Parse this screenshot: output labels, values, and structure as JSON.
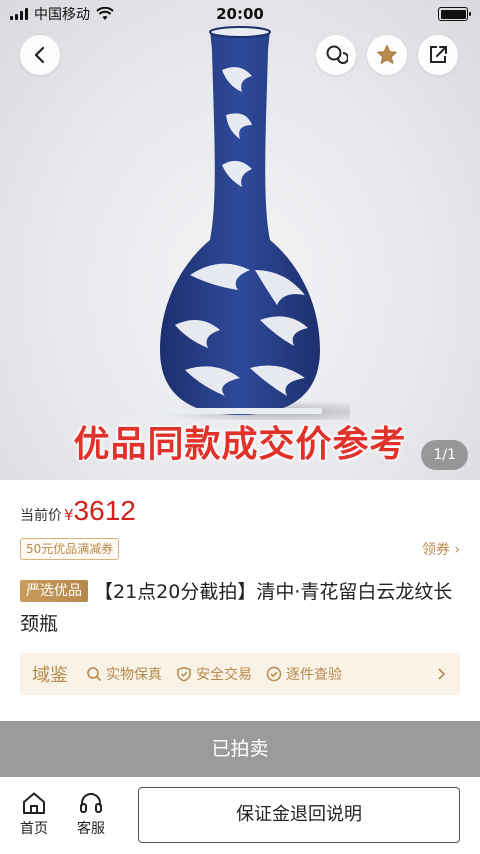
{
  "status": {
    "carrier": "中国移动",
    "time": "20:00"
  },
  "hero": {
    "banner": "优品同款成交价参考",
    "pager": "1/1"
  },
  "price": {
    "label": "当前价",
    "currency": "¥",
    "value": "3612"
  },
  "coupon": "50元优品满减券",
  "claim": "领券 ›",
  "item": {
    "tag": "严选优品",
    "title": "【21点20分截拍】清中·青花留白云龙纹长颈瓶"
  },
  "assurance": {
    "brand": "域鉴",
    "items": [
      "实物保真",
      "安全交易",
      "逐件查验"
    ]
  },
  "sold_label": "已拍卖",
  "bottom": {
    "home": "首页",
    "service": "客服",
    "deposit": "保证金退回说明"
  },
  "colors": {
    "price": "#d0211c",
    "gold": "#b88a4c",
    "banner": "#e0322b",
    "sold_bg": "#9b9b9b"
  },
  "icons": {
    "back": "chevron-left-icon",
    "chat": "chat-icon",
    "star": "star-icon",
    "share": "share-icon",
    "home": "home-icon",
    "headset": "headset-icon"
  }
}
